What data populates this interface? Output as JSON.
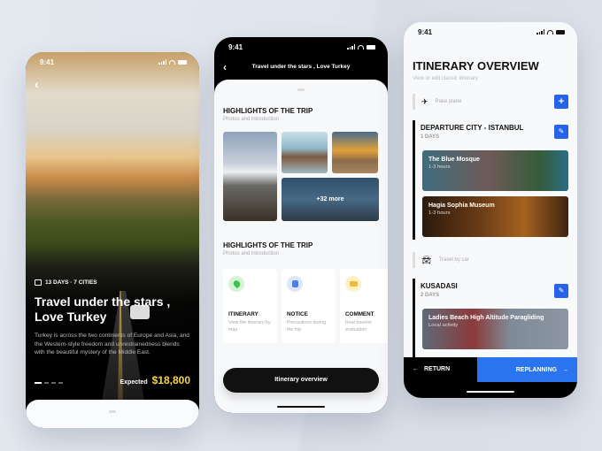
{
  "status_time": "9:41",
  "screen1": {
    "back_icon": "chevron-left-icon",
    "meta": "13 DAYS · 7 CITIES",
    "title": "Travel under the stars , Love Turkey",
    "description": "Turkey is across the two continents of Europe and Asia, and the Western-style freedom and unrestrainedness blends with the beautiful mystery of the Middle East.",
    "price_label": "Expected",
    "price_value": "$18,800",
    "pager": {
      "total": 4,
      "active": 1
    }
  },
  "screen2": {
    "nav_title": "Travel under the stars , Love Turkey",
    "section1": {
      "title": "HIGHLIGHTS OF THE TRIP",
      "subtitle": "Photos and introduction"
    },
    "more_label": "+32 more",
    "section2": {
      "title": "HIGHLIGHTS OF THE TRIP",
      "subtitle": "Photos and introduction"
    },
    "cards": [
      {
        "icon": "map-pin-icon",
        "title": "ITINERARY",
        "subtitle": "View the itinerary by map",
        "color": "#3fbf4f"
      },
      {
        "icon": "document-icon",
        "title": "NOTICE",
        "subtitle": "Precautions during the trip",
        "color": "#4a7fe8"
      },
      {
        "icon": "comment-icon",
        "title": "COMMENT",
        "subtitle": "Real traveler evaluation",
        "color": "#f5b82e"
      }
    ],
    "button_label": "Itinerary overview"
  },
  "screen3": {
    "title": "ITINERARY OVERVIEW",
    "subtitle": "View or edit classic itinerary",
    "transport1": "Pake plane",
    "add_label": "+",
    "city1": {
      "name": "DEPARTURE CITY - ISTANBUL",
      "days": "1 DAYS",
      "activities": [
        {
          "name": "The Blue Mosque",
          "duration": "1-3 hours"
        },
        {
          "name": "Hagia Sophia Museum",
          "duration": "1-3 hours"
        }
      ]
    },
    "transport2": "Travel by car",
    "city2": {
      "name": "KUSADASI",
      "days": "2 DAYS",
      "activities": [
        {
          "name": "Ladies Beach High Altitude Paragliding",
          "duration": "Local activity"
        }
      ]
    },
    "return_label": "RETURN",
    "replan_label": "REPLANNING",
    "accent": "#2b74f0"
  }
}
